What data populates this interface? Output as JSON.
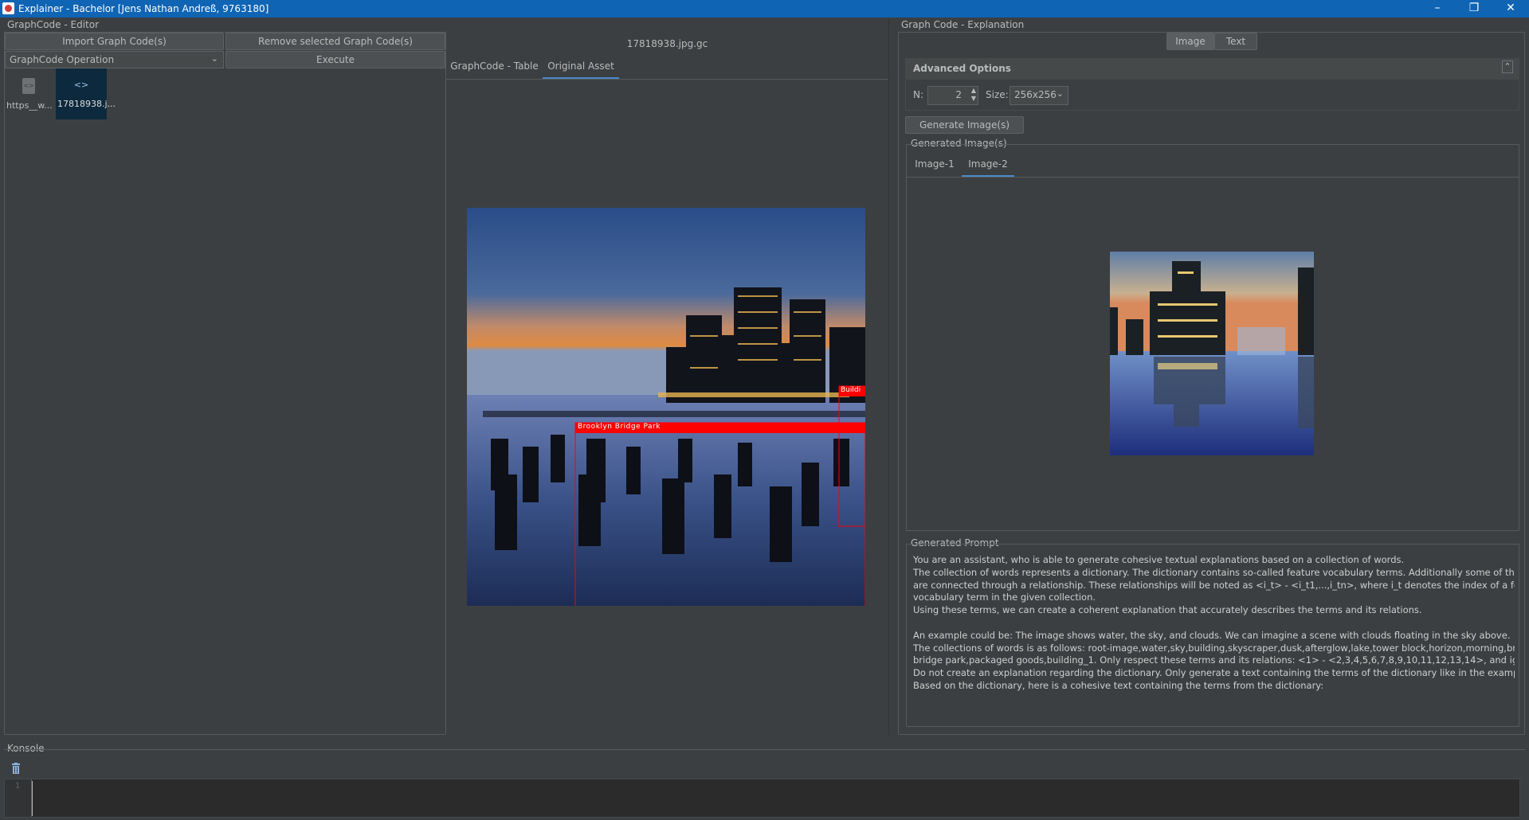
{
  "window": {
    "title": "Explainer - Bachelor [Jens Nathan Andreß, 9763180]"
  },
  "editor": {
    "section_title": "GraphCode - Editor",
    "import_btn": "Import Graph Code(s)",
    "remove_btn": "Remove selected Graph Code(s)",
    "operation_label": "GraphCode Operation",
    "execute_btn": "Execute",
    "files": [
      {
        "label": "https__w...",
        "icon": "file-code-icon"
      },
      {
        "label": "17818938.j...",
        "icon": "code-icon"
      }
    ]
  },
  "viewer": {
    "filename": "17818938.jpg.gc",
    "tabs": [
      "GraphCode - Table",
      "Original Asset"
    ],
    "active_tab": "Original Asset",
    "annotations": [
      "Brooklyn Bridge Park",
      "Buildi"
    ]
  },
  "explanation": {
    "section_title": "Graph Code - Explanation",
    "mode_tabs": [
      "Image",
      "Text"
    ],
    "active_mode": "Image",
    "advanced_title": "Advanced Options",
    "n_label": "N:",
    "n_value": "2",
    "size_label": "Size:",
    "size_value": "256x256",
    "generate_btn": "Generate Image(s)",
    "generated_title": "Generated Image(s)",
    "image_tabs": [
      "Image-1",
      "Image-2"
    ],
    "active_image_tab": "Image-2",
    "prompt_title": "Generated Prompt",
    "prompt_lines": [
      "You are an assistant, who is able to generate cohesive textual explanations based on a collection of words.",
      "The collection of words represents a dictionary. The dictionary contains so-called feature vocabulary terms. Additionally some of these terms",
      "are connected through a relationship. These relationships will be noted as <i_t> - <i_t1,...,i_tn>, where i_t denotes the index of a feature",
      "vocabulary term in the given collection.",
      "Using these terms, we can create a coherent explanation that accurately describes the terms and its relations.",
      "",
      "An example could be: The image shows water, the sky, and clouds. We can imagine a scene with clouds floating in the sky above.",
      "The collections of words is as follows: root-image,water,sky,building,skyscraper,dusk,afterglow,lake,tower block,horizon,morning,brooklyn",
      "bridge park,packaged goods,building_1. Only respect these terms and its relations: <1> - <2,3,4,5,6,7,8,9,10,11,12,13,14>, and ignore all others.",
      "Do not create an explanation regarding the dictionary. Only generate a text containing the terms of the dictionary like in the example above.",
      "Based on the dictionary, here is a cohesive text containing the terms from the dictionary:"
    ]
  },
  "console": {
    "title": "Konsole",
    "line_number": "1"
  },
  "colors": {
    "titlebar": "#0f64b4",
    "panel": "#3c3f41",
    "accent_tab": "#4a88c7",
    "annotation_red": "#ff0000"
  }
}
